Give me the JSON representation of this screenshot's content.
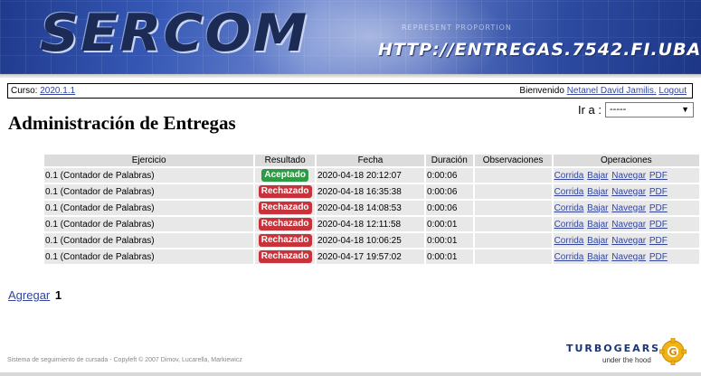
{
  "banner": {
    "logo": "SERCOM",
    "url": "HTTP://ENTREGAS.7542.FI.UBA.AR",
    "small_text": "REPRESENT PROPORTION"
  },
  "course_bar": {
    "course_label": "Curso:",
    "course_value": "2020.1.1",
    "welcome": "Bienvenido",
    "user": "Netanel David Jamilis.",
    "logout": "Logout"
  },
  "goto": {
    "label": "Ir a :",
    "selected": "-----"
  },
  "page_title": "Administración de Entregas",
  "table": {
    "headers": [
      "Ejercicio",
      "Resultado",
      "Fecha",
      "Duración",
      "Observaciones",
      "Operaciones"
    ],
    "rows": [
      {
        "ejercicio": "0.1 (Contador de Palabras)",
        "resultado": "Aceptado",
        "fecha": "2020-04-18 20:12:07",
        "duracion": "0:00:06",
        "observaciones": ""
      },
      {
        "ejercicio": "0.1 (Contador de Palabras)",
        "resultado": "Rechazado",
        "fecha": "2020-04-18 16:35:38",
        "duracion": "0:00:06",
        "observaciones": ""
      },
      {
        "ejercicio": "0.1 (Contador de Palabras)",
        "resultado": "Rechazado",
        "fecha": "2020-04-18 14:08:53",
        "duracion": "0:00:06",
        "observaciones": ""
      },
      {
        "ejercicio": "0.1 (Contador de Palabras)",
        "resultado": "Rechazado",
        "fecha": "2020-04-18 12:11:58",
        "duracion": "0:00:01",
        "observaciones": ""
      },
      {
        "ejercicio": "0.1 (Contador de Palabras)",
        "resultado": "Rechazado",
        "fecha": "2020-04-18 10:06:25",
        "duracion": "0:00:01",
        "observaciones": ""
      },
      {
        "ejercicio": "0.1 (Contador de Palabras)",
        "resultado": "Rechazado",
        "fecha": "2020-04-17 19:57:02",
        "duracion": "0:00:01",
        "observaciones": ""
      }
    ],
    "operations": [
      "Corrida",
      "Bajar",
      "Navegar",
      "PDF"
    ]
  },
  "pagination": {
    "add_label": "Agregar",
    "page": "1"
  },
  "footer": {
    "text": "Sistema de seguimiento de cursada - Copyleft © 2007 Dimov, Lucarella, Markiewicz",
    "tg_word": "TURBOGEARS",
    "tg_sub": "under the hood"
  },
  "colors": {
    "accepted": "#2e9a45",
    "rejected": "#c8323a",
    "link": "#33469b"
  }
}
